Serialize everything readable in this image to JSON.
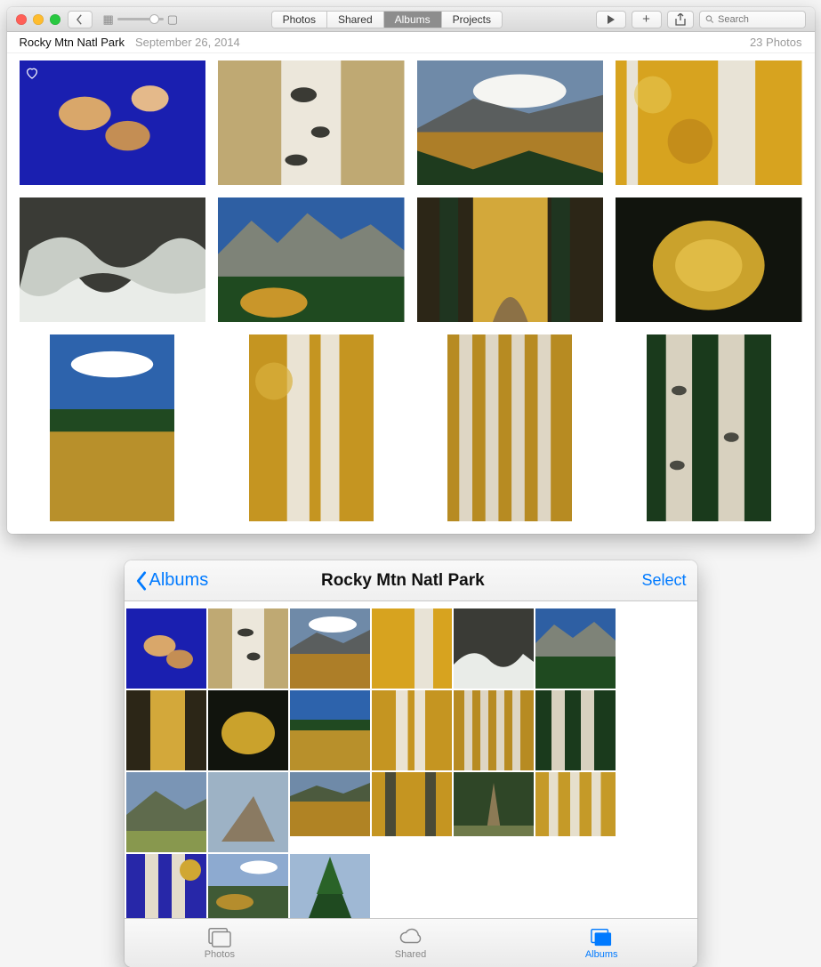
{
  "mac": {
    "tabs": [
      "Photos",
      "Shared",
      "Albums",
      "Projects"
    ],
    "active_tab": "Albums",
    "search_placeholder": "Search",
    "album_title": "Rocky Mtn Natl Park",
    "album_date": "September 26, 2014",
    "photo_count": "23 Photos"
  },
  "ios": {
    "back_label": "Albums",
    "title": "Rocky Mtn Natl Park",
    "select_label": "Select",
    "tabs": {
      "photos": "Photos",
      "shared": "Shared",
      "albums": "Albums"
    }
  }
}
